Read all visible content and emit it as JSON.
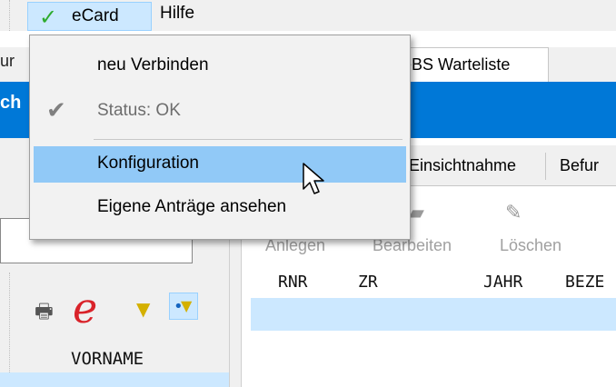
{
  "menubar": {
    "ecard_label": "eCard",
    "hilfe_label": "Hilfe"
  },
  "dropdown": {
    "items": [
      {
        "label": "neu Verbinden",
        "checked": false,
        "disabled": false
      },
      {
        "label": "Status: OK",
        "checked": true,
        "disabled": true
      },
      {
        "label": "Konfiguration",
        "checked": false,
        "disabled": false,
        "highlighted": true
      },
      {
        "label": "Eigene Anträge ansehen",
        "checked": false,
        "disabled": false
      }
    ]
  },
  "background": {
    "tab_partial": "ur",
    "tab_warteliste": "eBS Warteliste",
    "blue_bar_text": "ch",
    "subtabs": [
      "Einsichtnahme",
      "Befur"
    ],
    "toolbar": [
      "Anlegen",
      "Bearbeiten",
      "Löschen"
    ],
    "columns": [
      "RNR",
      "ZR",
      "JAHR",
      "BEZE"
    ],
    "left_column_header": "VORNAME"
  },
  "colors": {
    "accent": "#0078d7",
    "highlight": "#91c9f7",
    "selection": "#cce8ff",
    "check_green": "#2eab2e"
  },
  "icons": [
    "checkmark-icon",
    "printer-icon",
    "e-logo-icon",
    "filter-icon",
    "filter-user-icon",
    "folder-icon",
    "eraser-icon",
    "mouse-cursor-icon"
  ]
}
